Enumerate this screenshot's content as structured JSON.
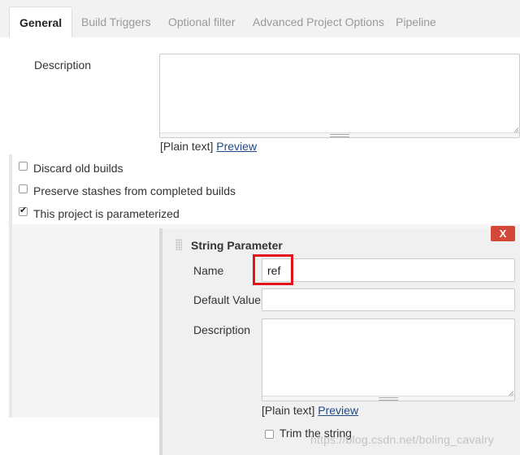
{
  "tabs": [
    {
      "label": "General"
    },
    {
      "label": "Build Triggers"
    },
    {
      "label": "Optional filter"
    },
    {
      "label": "Advanced Project Options"
    },
    {
      "label": "Pipeline"
    }
  ],
  "general": {
    "description_label": "Description",
    "description_value": "",
    "plain_text_label": "[Plain text]",
    "preview_link": "Preview",
    "checkboxes": [
      {
        "label": "Discard old builds",
        "checked": false
      },
      {
        "label": "Preserve stashes from completed builds",
        "checked": false
      },
      {
        "label": "This project is parameterized",
        "checked": true
      }
    ]
  },
  "string_parameter": {
    "title": "String Parameter",
    "delete_label": "X",
    "name_label": "Name",
    "name_value": "ref",
    "default_value_label": "Default Value",
    "default_value": "",
    "description_label": "Description",
    "plain_text_label": "[Plain text]",
    "preview_link": "Preview",
    "trim_label": "Trim the string",
    "trim_checked": false
  },
  "colors": {
    "delete_button": "#d24939",
    "highlight": "#e3131b",
    "link": "#204a87"
  },
  "watermark": "https://blog.csdn.net/boling_cavalry"
}
